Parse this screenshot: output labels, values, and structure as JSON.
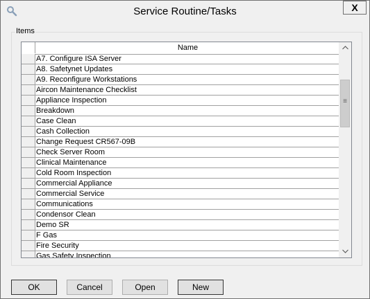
{
  "window": {
    "title": "Service Routine/Tasks",
    "close_label": "X"
  },
  "group": {
    "label": "Items"
  },
  "table": {
    "header": "Name",
    "rows": [
      "A7. Configure ISA Server",
      "A8. Safetynet Updates",
      "A9. Reconfigure Workstations",
      "Aircon Maintenance Checklist",
      "Appliance Inspection",
      "Breakdown",
      "Case Clean",
      "Cash Collection",
      "Change Request CR567-09B",
      "Check Server Room",
      "Clinical Maintenance",
      "Cold Room Inspection",
      "Commercial Appliance",
      "Commercial Service",
      "Communications",
      "Condensor Clean",
      "Demo SR",
      "F Gas",
      "Fire Security",
      "Gas Safety Inspection"
    ]
  },
  "buttons": {
    "ok": "OK",
    "cancel": "Cancel",
    "open": "Open",
    "new": "New"
  },
  "icons": {
    "title": "search-icon",
    "scroll_up": "chevron-up-icon",
    "scroll_down": "chevron-down-icon",
    "scroll_grip": "grip-icon"
  }
}
